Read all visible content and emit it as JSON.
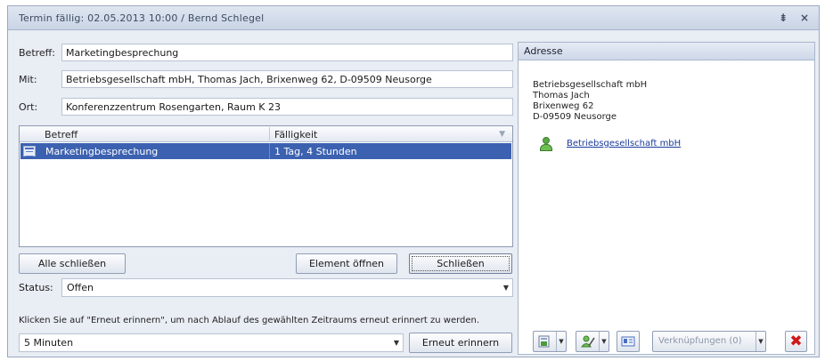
{
  "window": {
    "title": "Termin fällig: 02.05.2013 10:00 / Bernd Schlegel",
    "pin_glyph": "⇟",
    "close_glyph": "×"
  },
  "fields": {
    "betreff_label": "Betreff:",
    "betreff_value": "Marketingbesprechung",
    "mit_label": "Mit:",
    "mit_value": "Betriebsgesellschaft mbH, Thomas Jach, Brixenweg 62, D-09509 Neusorge",
    "ort_label": "Ort:",
    "ort_value": "Konferenzzentrum Rosengarten, Raum K 23"
  },
  "reminder_table": {
    "columns": [
      "Betreff",
      "Fälligkeit"
    ],
    "rows": [
      {
        "icon": "appointment-icon",
        "betreff": "Marketingbesprechung",
        "faelligkeit": "1 Tag, 4 Stunden",
        "selected": true
      }
    ]
  },
  "buttons": {
    "close_all": "Alle schließen",
    "open_element": "Element öffnen",
    "close": "Schließen",
    "snooze": "Erneut erinnern"
  },
  "status": {
    "label": "Status:",
    "value": "Offen"
  },
  "hint": "Klicken Sie auf \"Erneut erinnern\", um nach Ablauf des gewählten Zeitraums erneut erinnert zu werden.",
  "snooze_interval": {
    "value": "5 Minuten"
  },
  "address_panel": {
    "header": "Adresse",
    "lines": [
      "Betriebsgesellschaft mbH",
      "Thomas Jach",
      "Brixenweg 62",
      "D-09509 Neusorge"
    ],
    "contact_link": "Betriebsgesellschaft mbH"
  },
  "toolbar": {
    "links_button": "Verknüpfungen (0)"
  },
  "colors": {
    "selection": "#3c61b0",
    "link": "#1a3b9c",
    "delete": "#d01818"
  }
}
